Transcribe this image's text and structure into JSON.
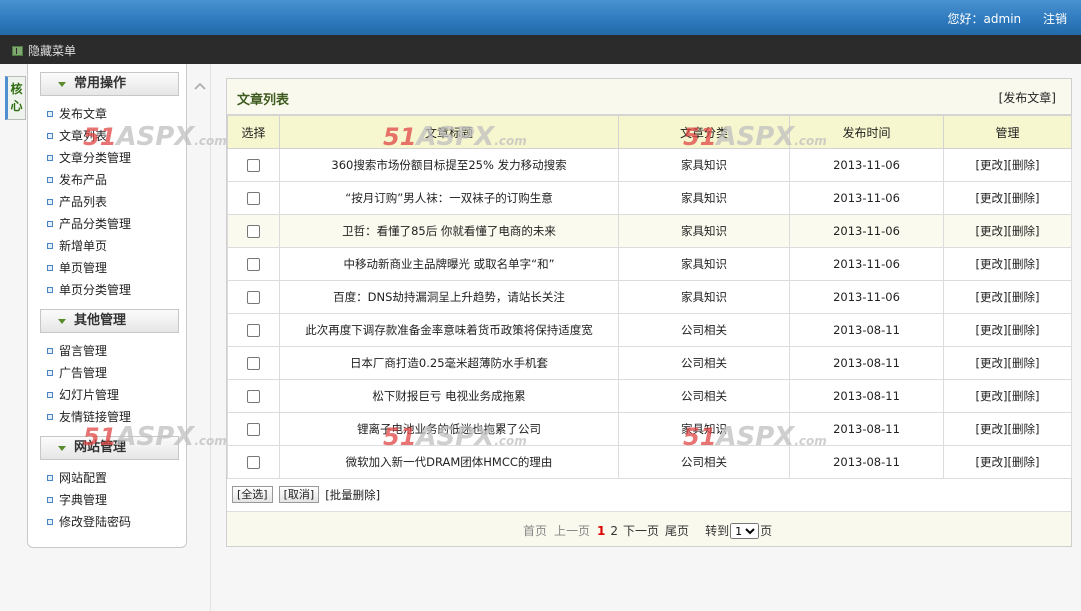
{
  "header": {
    "greeting": "您好：",
    "username": "admin",
    "logout": "注销"
  },
  "menubar": {
    "toggle_label": "隐藏菜单"
  },
  "vtab": {
    "label": "核心"
  },
  "sidebar": {
    "groups": [
      {
        "title": "常用操作",
        "items": [
          "发布文章",
          "文章列表",
          "文章分类管理",
          "发布产品",
          "产品列表",
          "产品分类管理",
          "新增单页",
          "单页管理",
          "单页分类管理"
        ]
      },
      {
        "title": "其他管理",
        "items": [
          "留言管理",
          "广告管理",
          "幻灯片管理",
          "友情链接管理"
        ]
      },
      {
        "title": "网站管理",
        "items": [
          "网站配置",
          "字典管理",
          "修改登陆密码"
        ]
      }
    ]
  },
  "panel": {
    "title": "文章列表",
    "publish_link": "[发布文章]"
  },
  "table": {
    "headers": [
      "选择",
      "文章标题",
      "文章分类",
      "发布时间",
      "管理"
    ],
    "rows": [
      {
        "title": "360搜索市场份额目标提至25% 发力移动搜索",
        "category": "家具知识",
        "date": "2013-11-06",
        "ops": "[更改][删除]"
      },
      {
        "title": "“按月订购”男人袜：一双袜子的订购生意",
        "category": "家具知识",
        "date": "2013-11-06",
        "ops": "[更改][删除]"
      },
      {
        "title": "卫哲：看懂了85后 你就看懂了电商的未来",
        "category": "家具知识",
        "date": "2013-11-06",
        "ops": "[更改][删除]"
      },
      {
        "title": "中移动新商业主品牌曝光 或取名单字“和”",
        "category": "家具知识",
        "date": "2013-11-06",
        "ops": "[更改][删除]"
      },
      {
        "title": "百度：DNS劫持漏洞呈上升趋势，请站长关注",
        "category": "家具知识",
        "date": "2013-11-06",
        "ops": "[更改][删除]"
      },
      {
        "title": "此次再度下调存款准备金率意味着货币政策将保持适度宽",
        "category": "公司相关",
        "date": "2013-08-11",
        "ops": "[更改][删除]"
      },
      {
        "title": "日本厂商打造0.25毫米超薄防水手机套",
        "category": "公司相关",
        "date": "2013-08-11",
        "ops": "[更改][删除]"
      },
      {
        "title": "松下财报巨亏 电视业务成拖累",
        "category": "公司相关",
        "date": "2013-08-11",
        "ops": "[更改][删除]"
      },
      {
        "title": "锂离子电池业务的低迷也拖累了公司",
        "category": "家具知识",
        "date": "2013-08-11",
        "ops": "[更改][删除]"
      },
      {
        "title": "微软加入新一代DRAM团体HMCC的理由",
        "category": "公司相关",
        "date": "2013-08-11",
        "ops": "[更改][删除]"
      }
    ]
  },
  "bulk": {
    "select_all": "[全选]",
    "cancel": "[取消]",
    "batch_delete": "[批量删除]"
  },
  "pager": {
    "first": "首页",
    "prev": "上一页",
    "page1": "1",
    "page2": "2",
    "next": "下一页",
    "last": "尾页",
    "goto": "转到",
    "selected": "1",
    "suffix": "页"
  },
  "watermark": {
    "n": "51",
    "a": "ASPX",
    "c": ".com"
  }
}
